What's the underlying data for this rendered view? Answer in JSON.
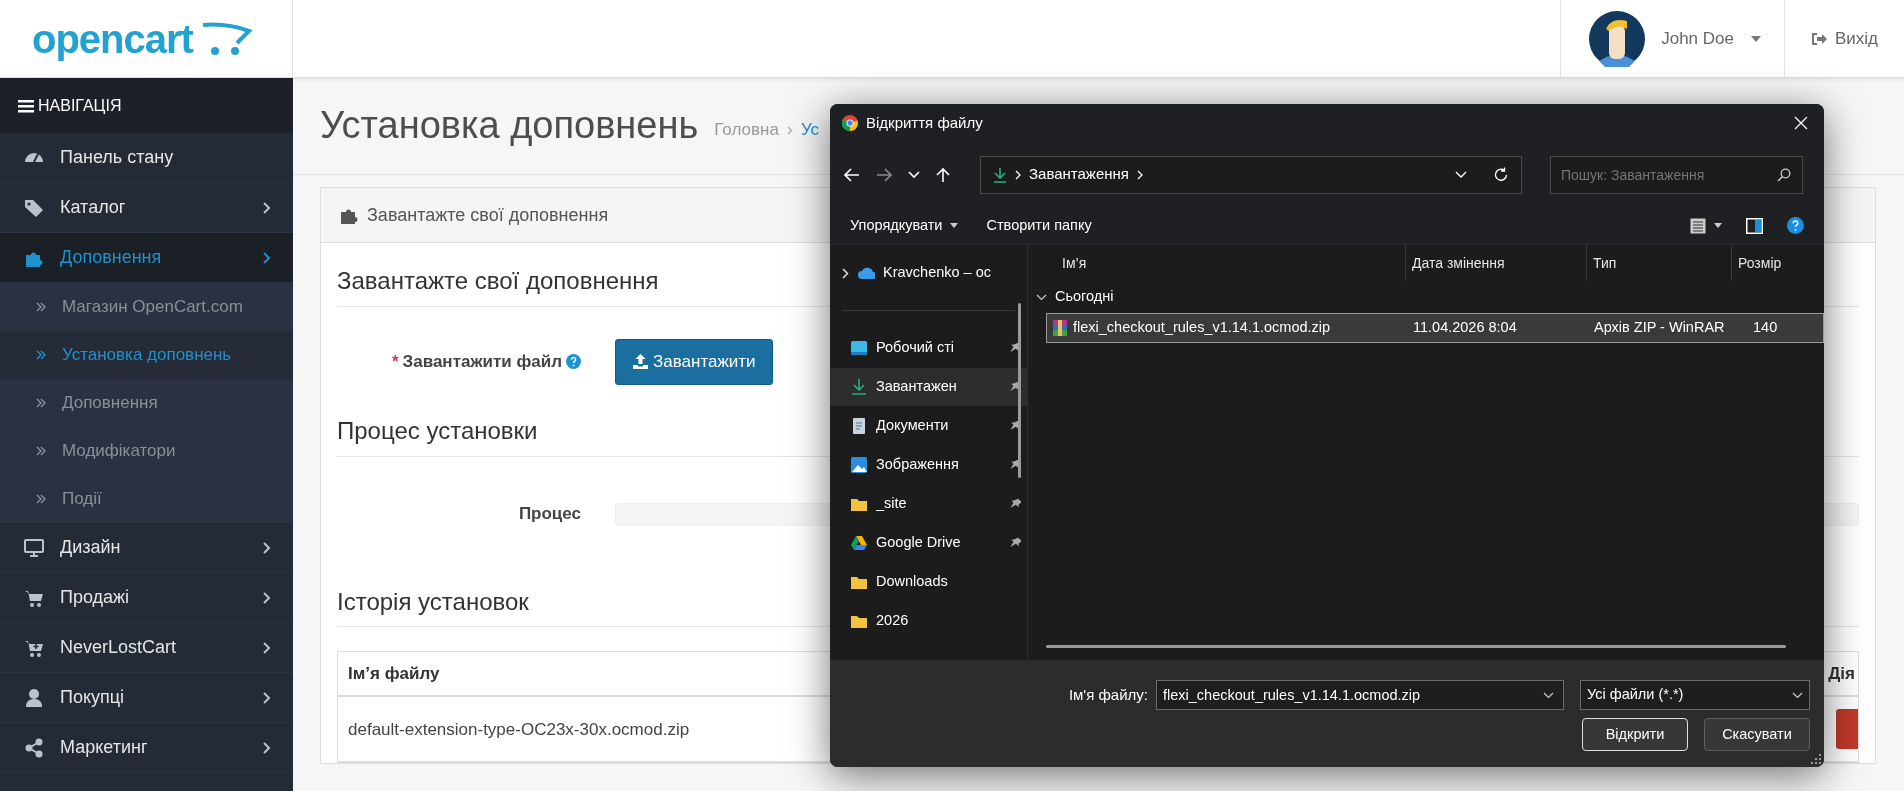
{
  "header": {
    "logo": "opencart",
    "user_name": "John Doe",
    "logout": "Вихід"
  },
  "sidebar": {
    "title": "НАВІГАЦІЯ",
    "items": [
      {
        "label": "Панель стану",
        "selected": false,
        "expandable": false
      },
      {
        "label": "Каталог",
        "selected": false,
        "expandable": true
      },
      {
        "label": "Доповнення",
        "selected": true,
        "expandable": true,
        "children": [
          {
            "label": "Магазин OpenCart.com",
            "selected": false
          },
          {
            "label": "Установка доповнень",
            "selected": true
          },
          {
            "label": "Доповнення",
            "selected": false
          },
          {
            "label": "Модифікатори",
            "selected": false
          },
          {
            "label": "Події",
            "selected": false
          }
        ]
      },
      {
        "label": "Дизайн",
        "selected": false,
        "expandable": true
      },
      {
        "label": "Продажі",
        "selected": false,
        "expandable": true
      },
      {
        "label": "NeverLostCart",
        "selected": false,
        "expandable": true
      },
      {
        "label": "Покупці",
        "selected": false,
        "expandable": true
      },
      {
        "label": "Маркетинг",
        "selected": false,
        "expandable": true
      }
    ]
  },
  "page": {
    "title": "Установка доповнень",
    "breadcrumb": [
      "Головна",
      "Ус"
    ],
    "panel_title": "Завантажте свої доповнення",
    "upload": {
      "heading": "Завантажте свої доповнення",
      "label": "Завантажити файл",
      "required_mark": "*",
      "button": "Завантажити"
    },
    "progress": {
      "heading": "Процес установки",
      "label": "Процес",
      "level": 0
    },
    "history": {
      "heading": "Історія установок",
      "columns": [
        "Ім’я файлу",
        "Дія"
      ],
      "rows": [
        {
          "file": "default-extension-type-OC23x-30x.ocmod.zip"
        }
      ]
    }
  },
  "dialog": {
    "title": "Відкриття файлу",
    "forward_disabled": true,
    "address": "Завантаження",
    "search_placeholder": "Пошук: Завантаження",
    "commands": [
      "Упорядкувати",
      "Створити папку"
    ],
    "nav_items": [
      {
        "label": "Kravchenko – oc",
        "kind": "cloud",
        "pinned": false,
        "selected": false
      },
      {
        "label": "Робочий сті",
        "kind": "desktop",
        "pinned": true,
        "selected": false
      },
      {
        "label": "Завантажен",
        "kind": "download",
        "pinned": true,
        "selected": true
      },
      {
        "label": "Документи",
        "kind": "document",
        "pinned": true,
        "selected": false
      },
      {
        "label": "Зображення",
        "kind": "pictures",
        "pinned": true,
        "selected": false
      },
      {
        "label": "_site",
        "kind": "folder",
        "pinned": true,
        "selected": false
      },
      {
        "label": "Google Drive",
        "kind": "drive",
        "pinned": true,
        "selected": false
      },
      {
        "label": "Downloads",
        "kind": "folder",
        "pinned": false,
        "selected": false
      },
      {
        "label": "2026",
        "kind": "folder",
        "pinned": false,
        "selected": false
      }
    ],
    "columns": [
      "Ім’я",
      "Дата змінення",
      "Тип",
      "Розмір"
    ],
    "groups": [
      {
        "label": "Сьогодні",
        "expanded": true,
        "files": [
          {
            "name": "flexi_checkout_rules_v1.14.1.ocmod.zip",
            "modified": "11.04.2026 8:04",
            "type": "Архів ZIP - WinRAR",
            "size": "140",
            "selected": true
          }
        ]
      }
    ],
    "file_name_label": "Ім'я файлу:",
    "file_name": "flexi_checkout_rules_v1.14.1.ocmod.zip",
    "filter": "Усі файли (*.*)",
    "buttons": [
      {
        "label": "Відкрити",
        "default": true
      },
      {
        "label": "Скасувати",
        "default": false
      }
    ]
  }
}
